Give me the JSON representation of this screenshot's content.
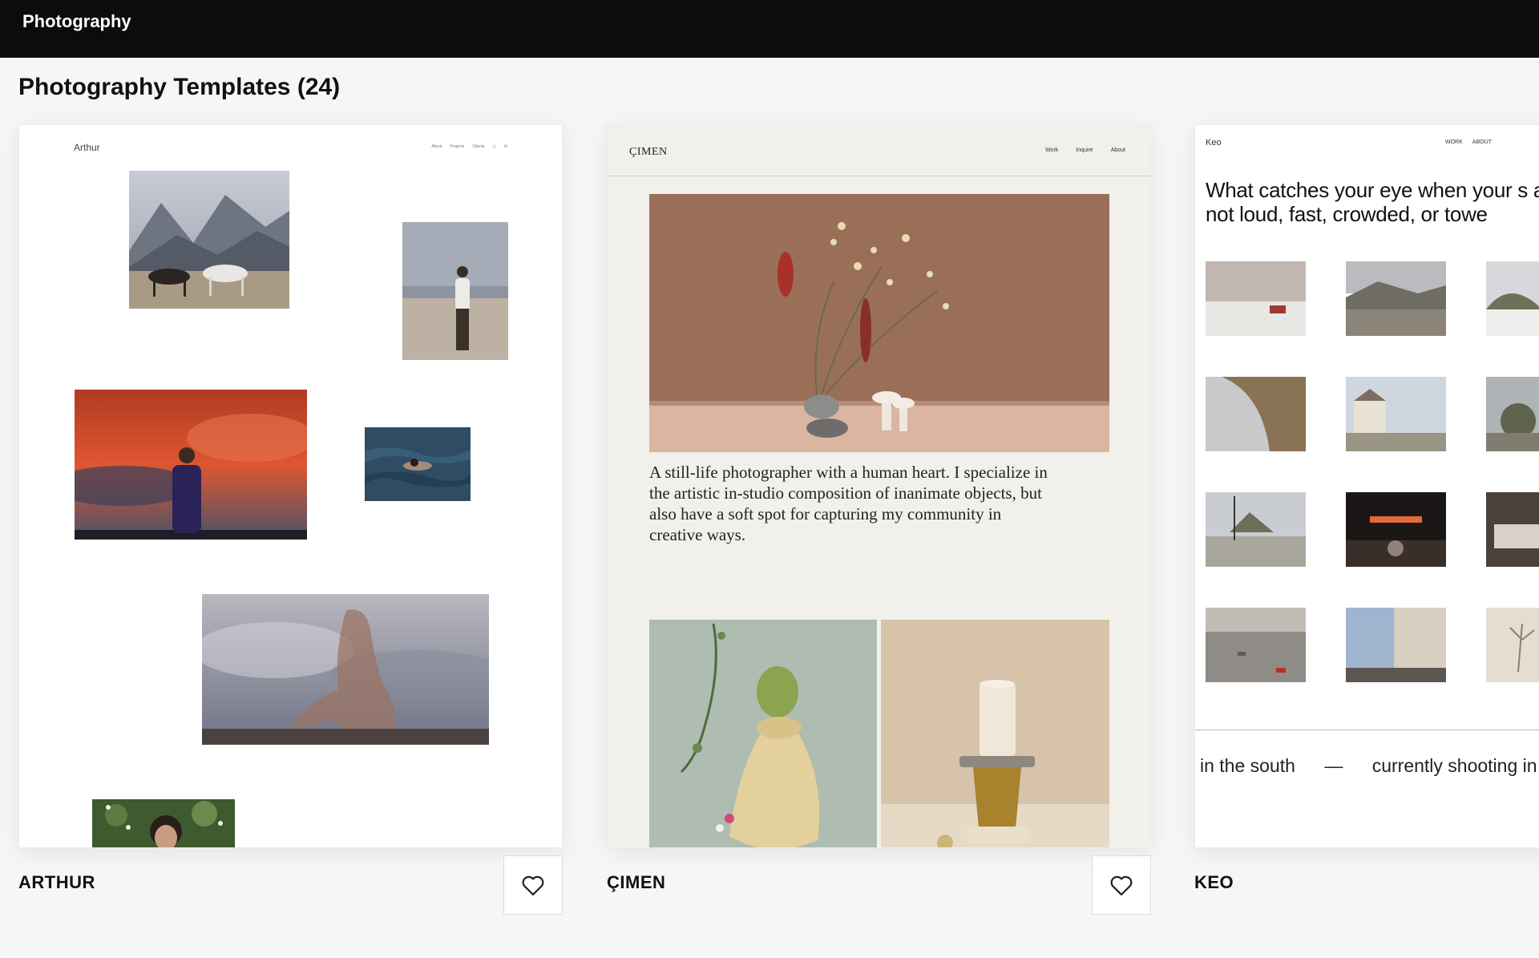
{
  "topbar": {
    "title": "Photography"
  },
  "page": {
    "title": "Photography Templates (24)"
  },
  "templates": [
    {
      "name": "ARTHUR",
      "preview": {
        "logo": "Arthur",
        "nav": [
          "About",
          "Projects",
          "Clients",
          "◻",
          "✉"
        ]
      }
    },
    {
      "name": "ÇIMEN",
      "preview": {
        "logo": "ÇIMEN",
        "nav": [
          "Work",
          "Inquire",
          "About"
        ],
        "intro": "A still-life photographer with a human heart. I specialize in the artistic in-studio composition of inanimate objects, but also have a soft spot for capturing my community in creative ways."
      }
    },
    {
      "name": "KEO",
      "preview": {
        "logo": "Keo",
        "nav": [
          "WORK",
          "ABOUT"
        ],
        "headline": "What catches your eye when your s are not loud, fast, crowded, or towe",
        "ticker": [
          "in the south",
          "—",
          "currently shooting in"
        ]
      }
    }
  ],
  "icons": {
    "favorite": "heart-outline-icon"
  },
  "colors": {
    "topbar": "#0c0c0c",
    "page_bg": "#f6f6f6",
    "cimen_bg": "#f2f0ea"
  }
}
